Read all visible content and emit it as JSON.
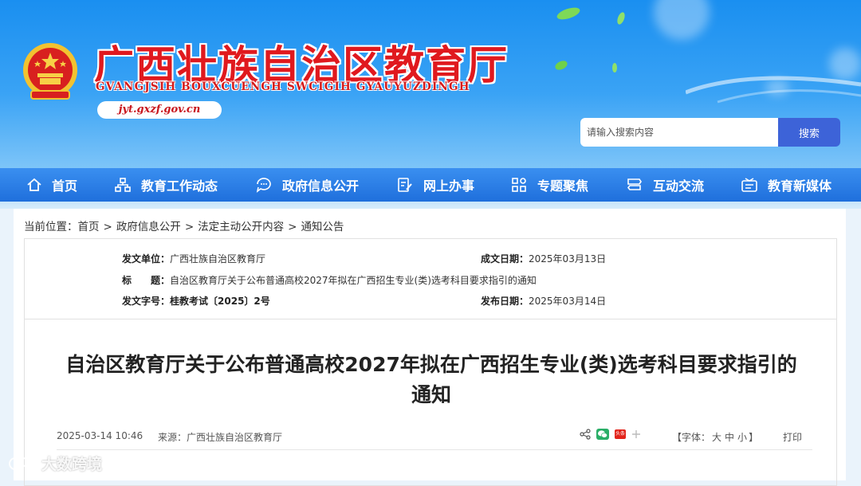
{
  "header": {
    "title": "广西壮族自治区教育厅",
    "subtitle": "GVANGJSIH BOUXCUENGH SWCIGIH GYAUYUZDINGH",
    "url": "jyt.gxzf.gov.cn",
    "emblem_icon": "national-emblem-icon"
  },
  "search": {
    "placeholder": "请输入搜索内容",
    "button_label": "搜索"
  },
  "nav": {
    "items": [
      {
        "label": "首页",
        "icon": "home-icon"
      },
      {
        "label": "教育工作动态",
        "icon": "org-chart-icon"
      },
      {
        "label": "政府信息公开",
        "icon": "chat-bubble-icon"
      },
      {
        "label": "网上办事",
        "icon": "document-edit-icon"
      },
      {
        "label": "专题聚焦",
        "icon": "grid-icon"
      },
      {
        "label": "互动交流",
        "icon": "signpost-icon"
      },
      {
        "label": "教育新媒体",
        "icon": "media-icon"
      }
    ]
  },
  "breadcrumb": {
    "prefix": "当前位置：",
    "items": [
      "首页",
      "政府信息公开",
      "法定主动公开内容",
      "通知公告"
    ],
    "separator": ">"
  },
  "meta": {
    "issuer_label": "发文单位：",
    "issuer_value": "广西壮族自治区教育厅",
    "created_label": "成文日期：",
    "created_value": "2025年03月13日",
    "title_label": "标　　题：",
    "title_value": "自治区教育厅关于公布普通高校2027年拟在广西招生专业(类)选考科目要求指引的通知",
    "docno_label": "发文字号：",
    "docno_value": "桂教考试〔2025〕2号",
    "published_label": "发布日期：",
    "published_value": "2025年03月14日"
  },
  "article": {
    "title_line1": "自治区教育厅关于公布普通高校2027年拟在广西招生专业(类)选考科目要求指引的",
    "title_line2": "通知",
    "datetime": "2025-03-14 10:46",
    "source_label": "来源：",
    "source_value": "广西壮族自治区教育厅",
    "font_label_open": "【字体：",
    "font_large": "大",
    "font_medium": "中",
    "font_small": "小",
    "font_label_close": "】",
    "print_label": "打印",
    "share_toutiao": "头条"
  },
  "watermark": {
    "text": "大数跨境"
  },
  "colors": {
    "brand_red": "#e0191e",
    "nav_blue": "#1f6fdc",
    "search_button": "#3d63d8",
    "wechat_green": "#2aae67"
  }
}
